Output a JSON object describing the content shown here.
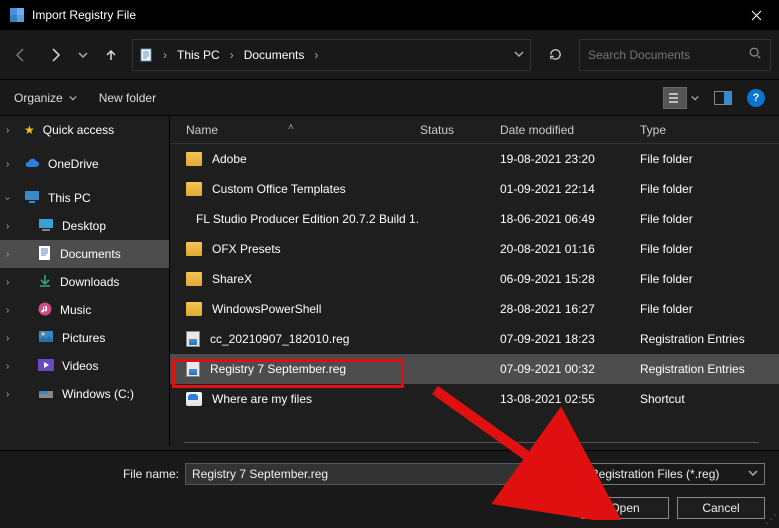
{
  "window": {
    "title": "Import Registry File"
  },
  "breadcrumb": {
    "items": [
      "This PC",
      "Documents"
    ]
  },
  "search": {
    "placeholder": "Search Documents"
  },
  "toolbar": {
    "organize": "Organize",
    "newfolder": "New folder"
  },
  "sidebar": {
    "quick": "Quick access",
    "onedrive": "OneDrive",
    "thispc": "This PC",
    "desktop": "Desktop",
    "documents": "Documents",
    "downloads": "Downloads",
    "music": "Music",
    "pictures": "Pictures",
    "videos": "Videos",
    "windowsc": "Windows (C:)"
  },
  "headers": {
    "name": "Name",
    "status": "Status",
    "date": "Date modified",
    "type": "Type"
  },
  "files": [
    {
      "icon": "folder",
      "name": "Adobe",
      "date": "19-08-2021 23:20",
      "type": "File folder"
    },
    {
      "icon": "folder",
      "name": "Custom Office Templates",
      "date": "01-09-2021 22:14",
      "type": "File folder"
    },
    {
      "icon": "folder",
      "name": "FL Studio Producer Edition 20.7.2 Build 1...",
      "date": "18-06-2021 06:49",
      "type": "File folder"
    },
    {
      "icon": "folder",
      "name": "OFX Presets",
      "date": "20-08-2021 01:16",
      "type": "File folder"
    },
    {
      "icon": "folder",
      "name": "ShareX",
      "date": "06-09-2021 15:28",
      "type": "File folder"
    },
    {
      "icon": "folder",
      "name": "WindowsPowerShell",
      "date": "28-08-2021 16:27",
      "type": "File folder"
    },
    {
      "icon": "reg",
      "name": "cc_20210907_182010.reg",
      "date": "07-09-2021 18:23",
      "type": "Registration Entries"
    },
    {
      "icon": "reg",
      "name": "Registry 7 September.reg",
      "date": "07-09-2021 00:32",
      "type": "Registration Entries"
    },
    {
      "icon": "shortcut",
      "name": "Where are my files",
      "date": "13-08-2021 02:55",
      "type": "Shortcut"
    }
  ],
  "filename": {
    "label": "File name:",
    "value": "Registry 7 September.reg"
  },
  "filter": {
    "value": "Registration Files (*.reg)"
  },
  "buttons": {
    "open": "Open",
    "cancel": "Cancel"
  }
}
